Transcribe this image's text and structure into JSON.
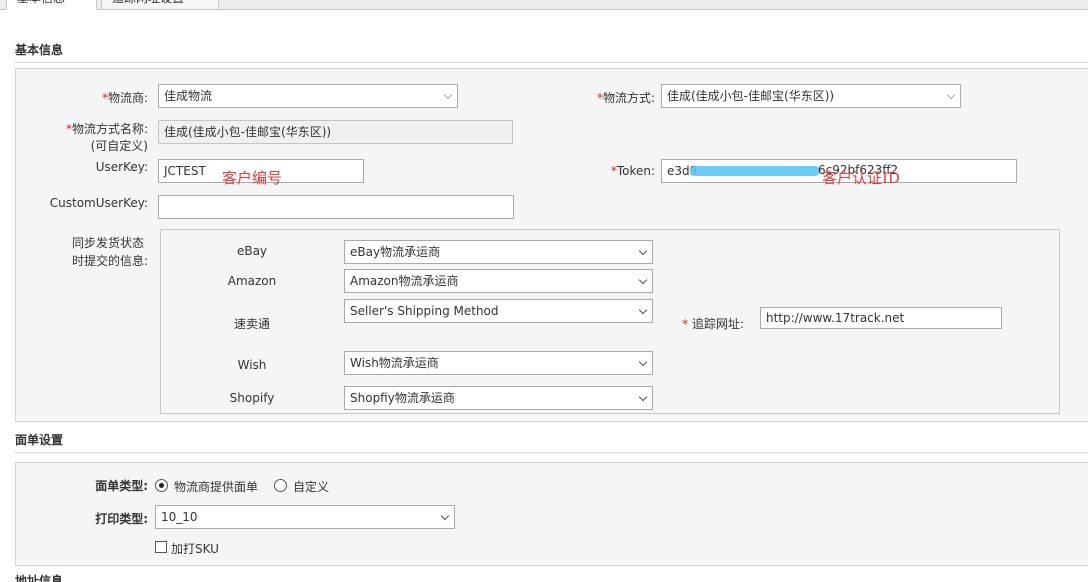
{
  "tabs": [
    {
      "label": "基本信息"
    },
    {
      "label": "追踪网址设置"
    }
  ],
  "basic": {
    "title": "基本信息",
    "carrier": {
      "label": "物流商:",
      "value": "佳成物流"
    },
    "method": {
      "label": "物流方式:",
      "value": "佳成(佳成小包-佳邮宝(华东区))"
    },
    "method_name": {
      "label_line1": "物流方式名称:",
      "label_line2": "(可自定义)",
      "value": "佳成(佳成小包-佳邮宝(华东区))"
    },
    "userkey": {
      "label": "UserKey:",
      "value": "JCTEST",
      "note": "客户编号"
    },
    "token": {
      "label": "Token:",
      "value_start": "e3d9",
      "value_end": "6c92bf623ff2",
      "note": "客户认证ID"
    },
    "custom_userkey": {
      "label": "CustomUserKey:",
      "value": ""
    },
    "sync": {
      "label_line1": "同步发货状态",
      "label_line2": "时提交的信息:",
      "rows": [
        {
          "platform": "eBay",
          "value": "eBay物流承运商"
        },
        {
          "platform": "Amazon",
          "value": "Amazon物流承运商"
        },
        {
          "platform": "速卖通",
          "value": "Seller's Shipping Method"
        },
        {
          "platform": "Wish",
          "value": "Wish物流承运商"
        },
        {
          "platform": "Shopify",
          "value": "Shopfiy物流承运商"
        }
      ],
      "tracking": {
        "label": "追踪网址:",
        "value": "http://www.17track.net"
      }
    }
  },
  "label_settings": {
    "title": "面单设置",
    "type": {
      "label": "面单类型:",
      "options": [
        "物流商提供面单",
        "自定义"
      ],
      "selected": 0
    },
    "print": {
      "label": "打印类型:",
      "value": "10_10"
    },
    "sku": {
      "label": "加打SKU",
      "checked": false
    }
  },
  "address": {
    "title": "地址信息"
  },
  "colors": {
    "required": "#e02020",
    "annotation": "#e04040",
    "blur": "#5bc8f5"
  }
}
